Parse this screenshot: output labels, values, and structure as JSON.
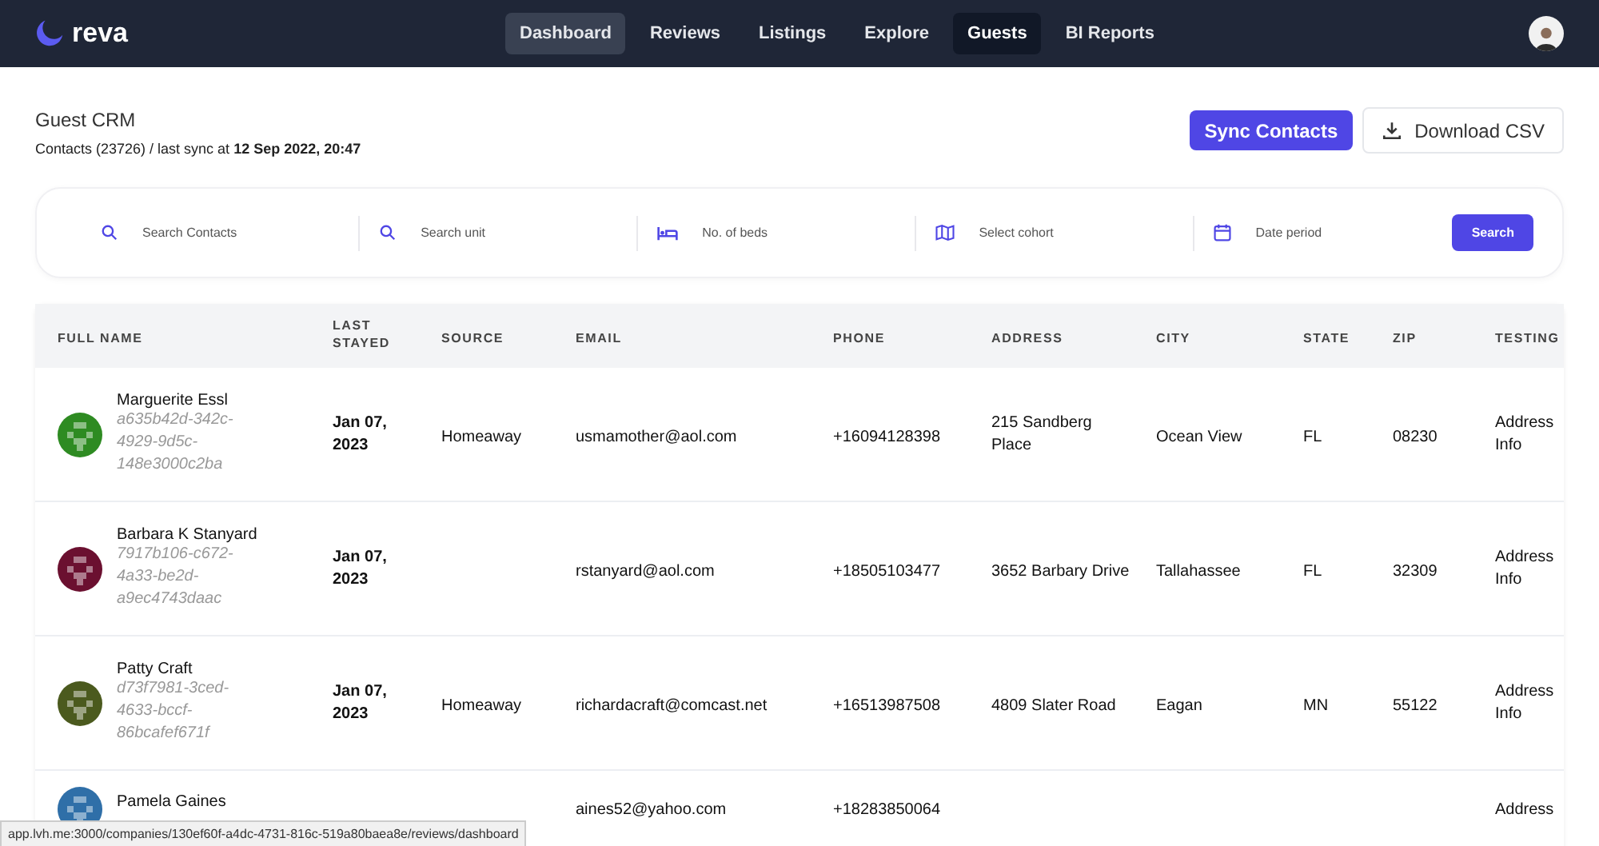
{
  "brand": "reva",
  "nav": [
    {
      "label": "Dashboard",
      "selected": false,
      "hovered": true
    },
    {
      "label": "Reviews",
      "selected": false,
      "hovered": false
    },
    {
      "label": "Listings",
      "selected": false,
      "hovered": false
    },
    {
      "label": "Explore",
      "selected": false,
      "hovered": false
    },
    {
      "label": "Guests",
      "selected": true,
      "hovered": false
    },
    {
      "label": "BI Reports",
      "selected": false,
      "hovered": false
    }
  ],
  "page": {
    "title": "Guest CRM",
    "subtitle_prefix": "Contacts (23726) / last sync at",
    "sync_time": "12 Sep 2022, 20:47"
  },
  "actions": {
    "sync": "Sync Contacts",
    "download": "Download CSV"
  },
  "filters": [
    {
      "placeholder": "Search Contacts"
    },
    {
      "placeholder": "Search unit"
    },
    {
      "placeholder": "No. of beds"
    },
    {
      "placeholder": "Select cohort"
    },
    {
      "placeholder": "Date period"
    }
  ],
  "search_button": "Search",
  "table": {
    "columns": [
      "FULL NAME",
      "LAST STAYED",
      "SOURCE",
      "EMAIL",
      "PHONE",
      "ADDRESS",
      "CITY",
      "STATE",
      "ZIP",
      "TESTING"
    ],
    "rows": [
      {
        "name": "Marguerite Essl",
        "id": "a635b42d-342c-4929-9d5c-148e3000c2ba",
        "color": "#2e8b22",
        "last_stayed": "Jan 07, 2023",
        "source": "Homeaway",
        "email": "usmamother@aol.com",
        "phone": "+16094128398",
        "address": "215 Sandberg Place",
        "city": "Ocean View",
        "state": "FL",
        "zip": "08230",
        "testing": "Address Info"
      },
      {
        "name": "Barbara K Stanyard",
        "id": "7917b106-c672-4a33-be2d-a9ec4743daac",
        "color": "#6b1030",
        "last_stayed": "Jan 07, 2023",
        "source": "",
        "email": "rstanyard@aol.com",
        "phone": "+18505103477",
        "address": "3652 Barbary Drive",
        "city": "Tallahassee",
        "state": "FL",
        "zip": "32309",
        "testing": "Address Info"
      },
      {
        "name": "Patty Craft",
        "id": "d73f7981-3ced-4633-bccf-86bcafef671f",
        "color": "#4b5a1e",
        "last_stayed": "Jan 07, 2023",
        "source": "Homeaway",
        "email": "richardacraft@comcast.net",
        "phone": "+16513987508",
        "address": "4809 Slater Road",
        "city": "Eagan",
        "state": "MN",
        "zip": "55122",
        "testing": "Address Info"
      },
      {
        "name": "Pamela Gaines",
        "id": "",
        "color": "#2f6fa8",
        "last_stayed": "",
        "source": "",
        "email": "aines52@yahoo.com",
        "phone": "+18283850064",
        "address": "",
        "city": "",
        "state": "",
        "zip": "",
        "testing": "Address"
      }
    ]
  },
  "status_url": "app.lvh.me:3000/companies/130ef60f-a4dc-4731-816c-519a80baea8e/reviews/dashboard"
}
